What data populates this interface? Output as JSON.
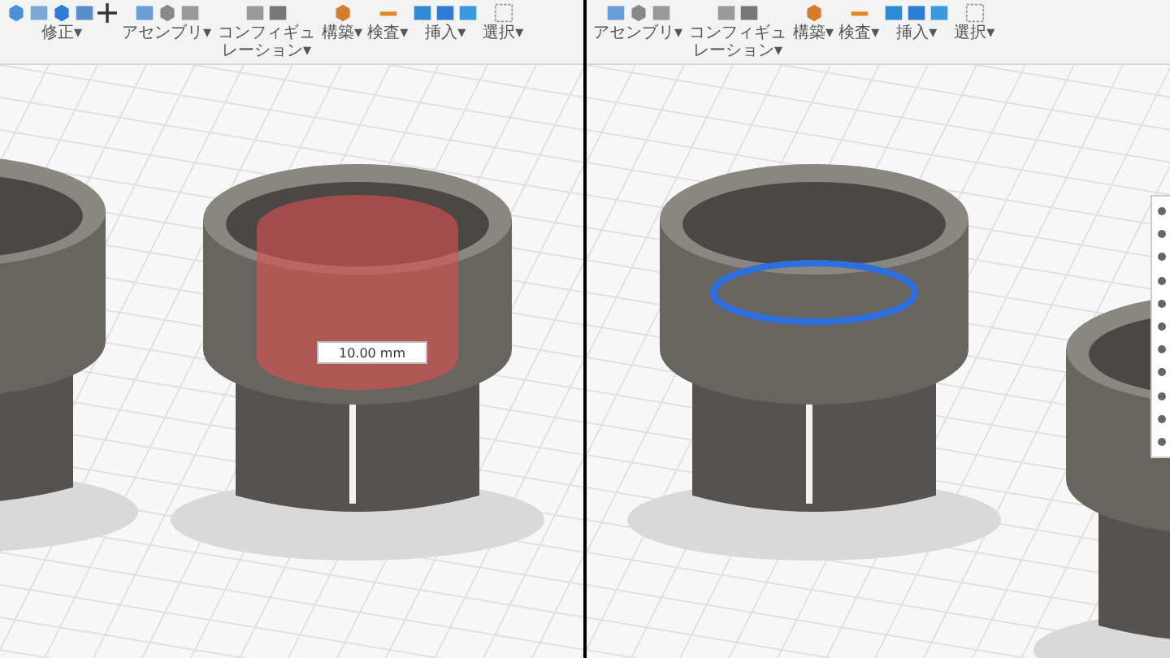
{
  "panels": [
    {
      "toolbar": [
        {
          "kind": "modify",
          "label": "修正▾"
        },
        {
          "kind": "assemble",
          "label": "アセンブリ▾"
        },
        {
          "kind": "configure",
          "label": "コンフィギュレーション▾"
        },
        {
          "kind": "construct",
          "label": "構築▾"
        },
        {
          "kind": "inspect",
          "label": "検査▾"
        },
        {
          "kind": "insert",
          "label": "挿入▾"
        },
        {
          "kind": "select",
          "label": "選択▾"
        }
      ],
      "viewport": {
        "kind": "extrude",
        "dimension_input": {
          "value": "10.00 mm"
        }
      }
    },
    {
      "toolbar": [
        {
          "kind": "assemble",
          "label": "アセンブリ▾"
        },
        {
          "kind": "configure",
          "label": "コンフィギュレーション▾"
        },
        {
          "kind": "construct",
          "label": "構築▾"
        },
        {
          "kind": "inspect",
          "label": "検査▾"
        },
        {
          "kind": "insert",
          "label": "挿入▾"
        },
        {
          "kind": "select",
          "label": "選択▾"
        }
      ],
      "viewport": {
        "kind": "selection",
        "context_menu": true
      }
    }
  ]
}
